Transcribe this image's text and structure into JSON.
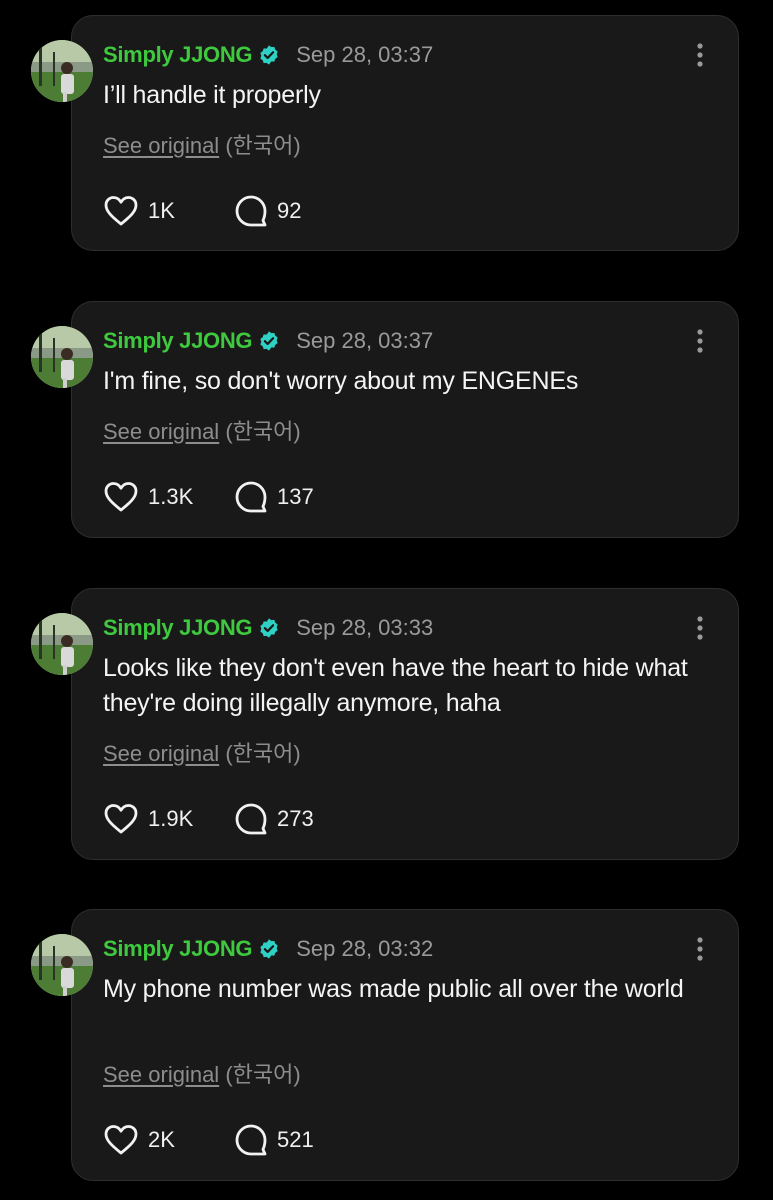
{
  "colors": {
    "background": "#000000",
    "card": "#191919",
    "username": "#3ec93f",
    "verified_badge": "#2ed1c4",
    "meta_text": "#9a9a9a"
  },
  "posts": [
    {
      "author": "Simply JJONG",
      "verified": true,
      "timestamp": "Sep 28, 03:37",
      "text": "I’ll handle it properly",
      "see_original": "See original",
      "language": "(한국어)",
      "likes": "1K",
      "comments": "92"
    },
    {
      "author": "Simply JJONG",
      "verified": true,
      "timestamp": "Sep 28, 03:37",
      "text": "I'm fine, so don't worry about my ENGENEs",
      "see_original": "See original",
      "language": "(한국어)",
      "likes": "1.3K",
      "comments": "137"
    },
    {
      "author": "Simply JJONG",
      "verified": true,
      "timestamp": "Sep 28, 03:33",
      "text": "Looks like they don't even have the heart to hide what they're doing illegally anymore, haha",
      "see_original": "See original",
      "language": "(한국어)",
      "likes": "1.9K",
      "comments": "273"
    },
    {
      "author": "Simply JJONG",
      "verified": true,
      "timestamp": "Sep 28, 03:32",
      "text": "My phone number was made public all over the world",
      "see_original": "See original",
      "language": "(한국어)",
      "likes": "2K",
      "comments": "521"
    }
  ],
  "icons": {
    "avatar": "profile-photo",
    "verified": "verified-check-badge",
    "menu": "vertical-ellipsis",
    "like": "heart-outline",
    "comment": "speech-bubble-outline"
  }
}
